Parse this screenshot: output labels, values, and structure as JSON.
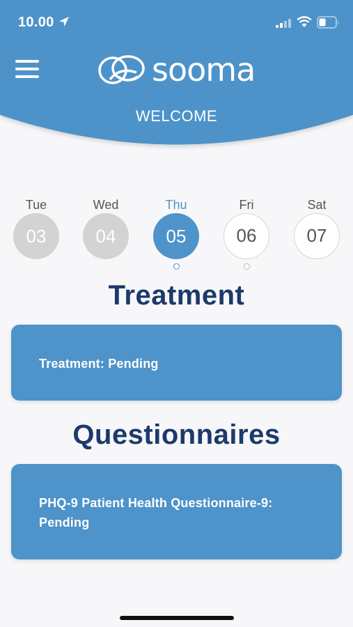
{
  "status_bar": {
    "time": "10.00",
    "icons": [
      "location-arrow-icon",
      "cellular-signal-icon",
      "wifi-icon",
      "battery-icon"
    ]
  },
  "header": {
    "brand": "sooma",
    "welcome": "WELCOME",
    "menu_icon": "hamburger-menu-icon"
  },
  "days": [
    {
      "name": "Tue",
      "date": "03",
      "state": "past"
    },
    {
      "name": "Wed",
      "date": "04",
      "state": "past"
    },
    {
      "name": "Thu",
      "date": "05",
      "state": "current"
    },
    {
      "name": "Fri",
      "date": "06",
      "state": "future"
    },
    {
      "name": "Sat",
      "date": "07",
      "state": "future"
    }
  ],
  "treatment": {
    "title": "Treatment",
    "status": "Treatment: Pending"
  },
  "questionnaires": {
    "title": "Questionnaires",
    "status": "PHQ-9 Patient Health Questionnaire-9: Pending"
  },
  "colors": {
    "primary": "#4e93c9",
    "title": "#1c3a6b",
    "background": "#f7f7f9",
    "past_day": "#d3d3d3"
  }
}
